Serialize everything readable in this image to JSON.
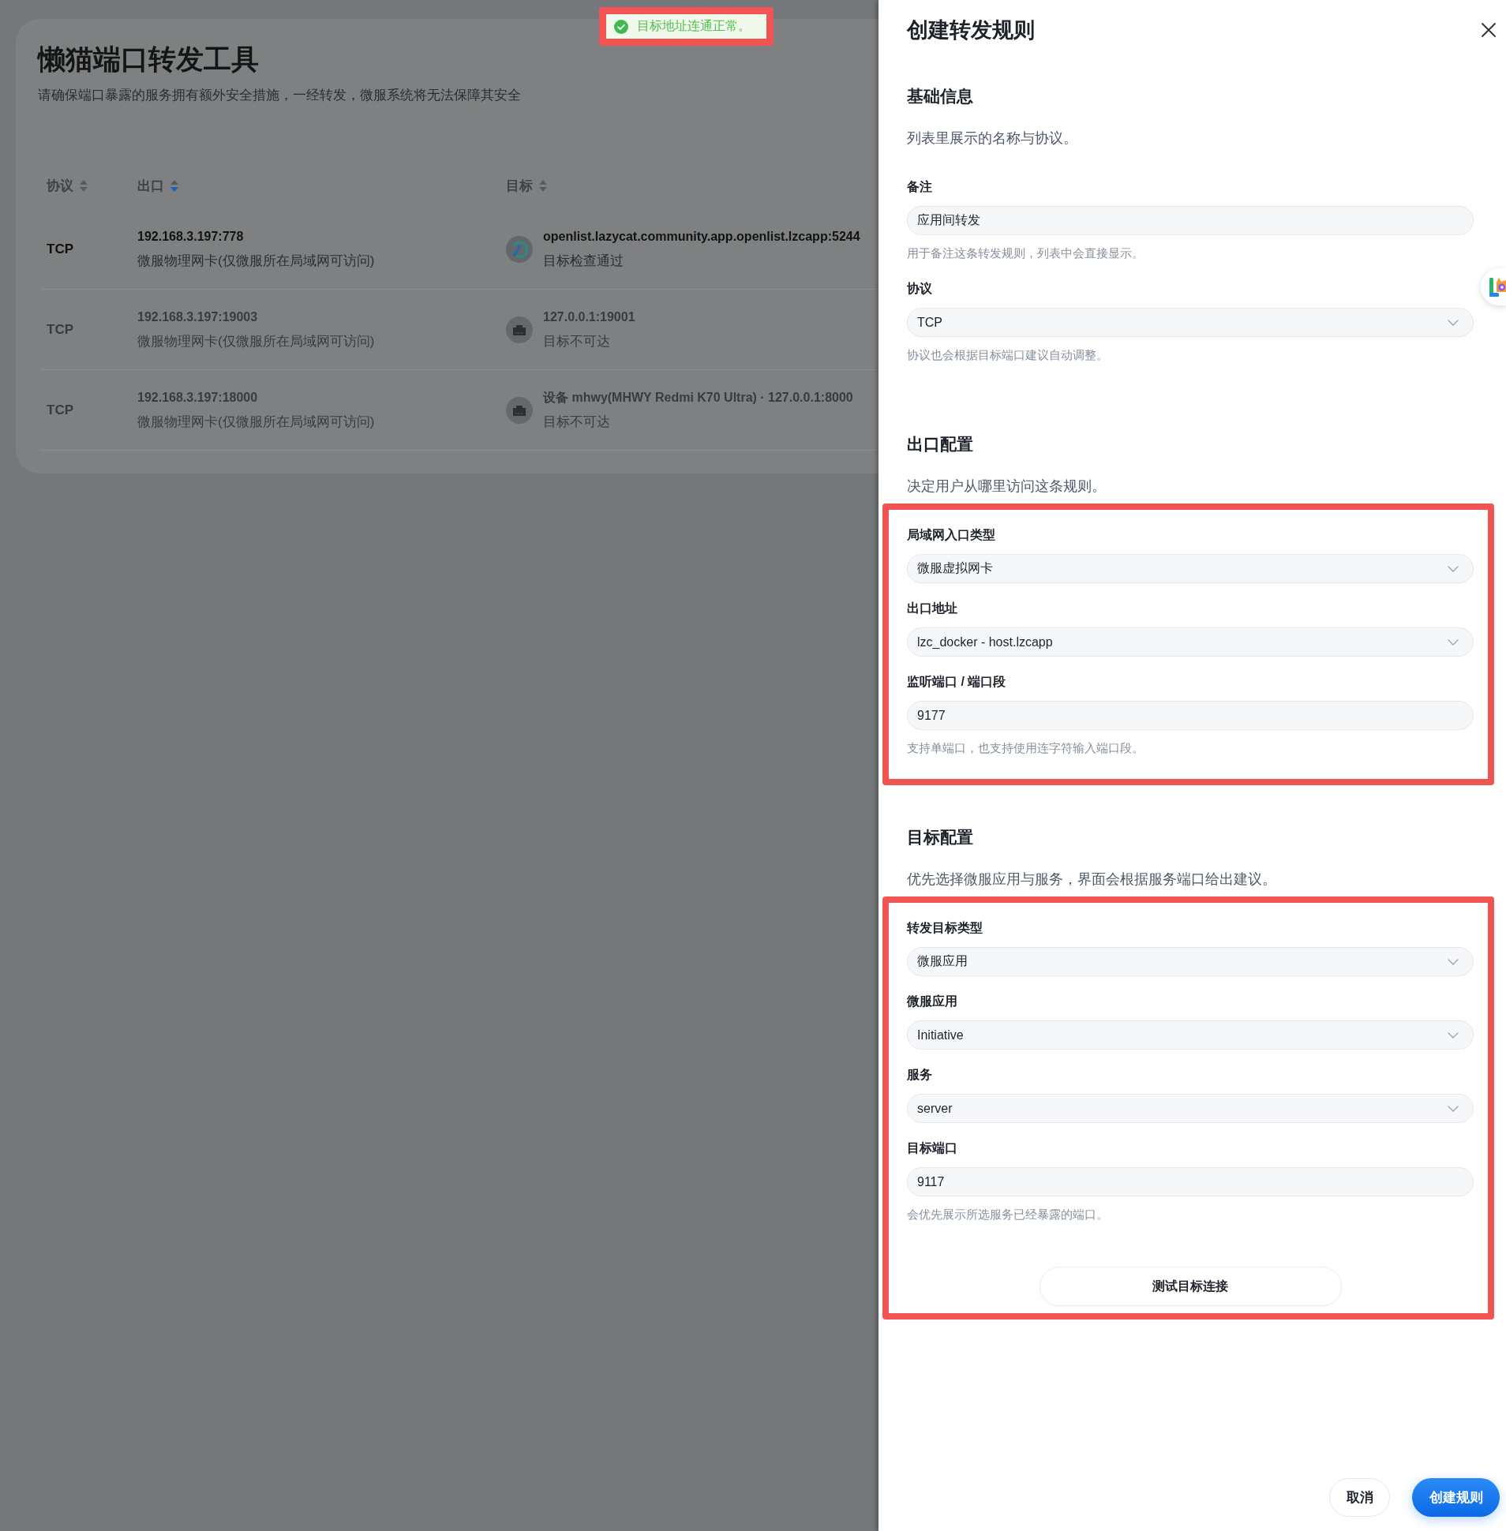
{
  "page": {
    "title": "懒猫端口转发工具",
    "subtitle": "请确保端口暴露的服务拥有额外安全措施，一经转发，微服系统将无法保障其安全"
  },
  "table": {
    "columns": [
      {
        "label": "协议",
        "sorted": false
      },
      {
        "label": "出口",
        "sorted": true
      },
      {
        "label": "目标",
        "sorted": false
      }
    ],
    "rows": [
      {
        "protocol": "TCP",
        "exit_address": "192.168.3.197:778",
        "exit_interface": "微服物理网卡(仅微服所在局域网可访问)",
        "target": {
          "kind": "app",
          "address": "openlist.lazycat.community.app.openlist.lzcapp:5244",
          "status": "目标检查通过"
        },
        "disabled": false
      },
      {
        "protocol": "TCP",
        "exit_address": "192.168.3.197:19003",
        "exit_interface": "微服物理网卡(仅微服所在局域网可访问)",
        "target": {
          "kind": "network",
          "address": "127.0.0.1:19001",
          "status": "目标不可达"
        },
        "disabled": true
      },
      {
        "protocol": "TCP",
        "exit_address": "192.168.3.197:18000",
        "exit_interface": "微服物理网卡(仅微服所在局域网可访问)",
        "target": {
          "kind": "network",
          "address": "设备 mhwy(MHWY Redmi K70 Ultra) · 127.0.0.1:8000",
          "status": "目标不可达"
        },
        "disabled": true
      }
    ]
  },
  "toast": {
    "kind": "success",
    "text": "目标地址连通正常。",
    "highlighted": true
  },
  "drawer": {
    "title": "创建转发规则",
    "sections": [
      {
        "title": "基础信息",
        "description": "列表里展示的名称与协议。",
        "highlighted": false,
        "fields": [
          {
            "kind": "input",
            "label": "备注",
            "value": "应用间转发",
            "hint": "用于备注这条转发规则，列表中会直接显示。"
          },
          {
            "kind": "select",
            "label": "协议",
            "value": "TCP",
            "hint": "协议也会根据目标端口建议自动调整。"
          }
        ]
      },
      {
        "title": "出口配置",
        "description": "决定用户从哪里访问这条规则。",
        "highlighted": true,
        "fields": [
          {
            "kind": "select",
            "label": "局域网入口类型",
            "value": "微服虚拟网卡"
          },
          {
            "kind": "select",
            "label": "出口地址",
            "value": "lzc_docker - host.lzcapp"
          },
          {
            "kind": "input",
            "label": "监听端口 / 端口段",
            "value": "9177",
            "hint": "支持单端口，也支持使用连字符输入端口段。"
          }
        ]
      },
      {
        "title": "目标配置",
        "description": "优先选择微服应用与服务，界面会根据服务端口给出建议。",
        "highlighted": true,
        "fields": [
          {
            "kind": "select",
            "label": "转发目标类型",
            "value": "微服应用"
          },
          {
            "kind": "select",
            "label": "微服应用",
            "value": "Initiative"
          },
          {
            "kind": "select",
            "label": "服务",
            "value": "server"
          },
          {
            "kind": "input",
            "label": "目标端口",
            "value": "9117",
            "hint": "会优先展示所选服务已经暴露的端口。"
          }
        ],
        "action": "测试目标连接"
      }
    ],
    "buttons": [
      {
        "kind": "secondary",
        "label": "取消"
      },
      {
        "kind": "primary",
        "label": "创建规则"
      }
    ]
  }
}
